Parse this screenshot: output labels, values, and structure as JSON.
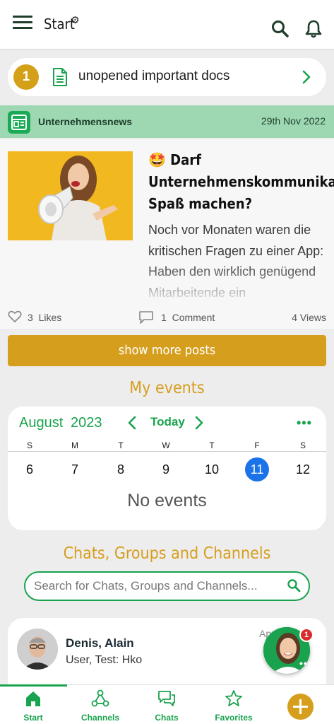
{
  "appbar": {
    "title": "Start",
    "title_gear_glyph": "⚙",
    "menu_icon": "hamburger-menu-icon",
    "search_icon": "search-icon",
    "bell_icon": "bell-icon"
  },
  "docs": {
    "count": "1",
    "label": "unopened important docs"
  },
  "news": {
    "source": "Unternehmensnews",
    "date": "29th Nov 2022",
    "headline_emoji": "🤩",
    "headline": "Darf Unternehmenskommunikation Spaß machen?",
    "excerpt": "Noch vor Monaten waren die kritischen Fragen zu einer App: Haben den wirklich genügend Mitarbeitende ein",
    "likes_count": "3",
    "likes_label": "Likes",
    "comments_count": "1",
    "comments_label": "Comment",
    "views": "4 Views"
  },
  "show_more_label": "show more posts",
  "events": {
    "title": "My events",
    "month": "August",
    "year": "2023",
    "today_label": "Today",
    "more_glyph": "•••",
    "weekdays": [
      "S",
      "M",
      "T",
      "W",
      "T",
      "F",
      "S"
    ],
    "days": [
      "6",
      "7",
      "8",
      "9",
      "10",
      "11",
      "12"
    ],
    "selected_day": "11",
    "empty_text": "No events"
  },
  "chats": {
    "title": "Chats, Groups and Channels",
    "search_placeholder": "Search for Chats, Groups and Channels...",
    "item": {
      "name": "Denis, Alain",
      "sender": "User, Test:",
      "message": "Hko",
      "time": "Apr 13"
    },
    "bot_badge": "1",
    "bot_dots": "•••"
  },
  "bottom_nav": {
    "items": [
      {
        "label": "Start",
        "icon": "home-icon"
      },
      {
        "label": "Channels",
        "icon": "channels-icon"
      },
      {
        "label": "Chats",
        "icon": "chat-bubbles-icon"
      },
      {
        "label": "Favorites",
        "icon": "star-icon"
      }
    ],
    "plus_icon": "plus-icon"
  },
  "colors": {
    "brand_green": "#1aa34e",
    "accent_gold": "#d69e1d",
    "news_header_bg": "#9ed8b3",
    "selected_day": "#1a73e8"
  }
}
